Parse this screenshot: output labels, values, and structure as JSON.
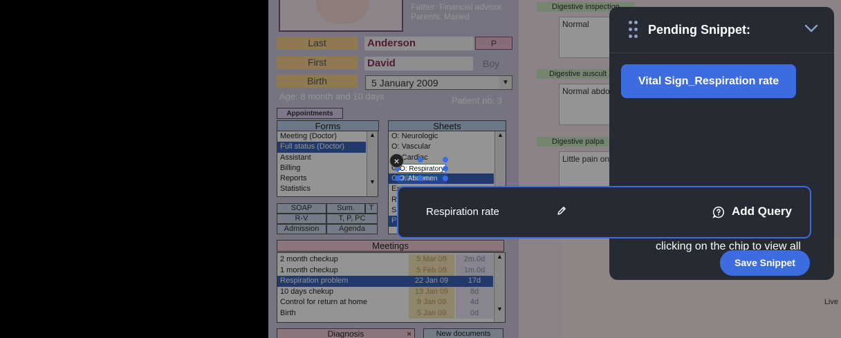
{
  "patient": {
    "father": "Father: Financial advisor",
    "parents": "Parents: Maried",
    "last_label": "Last",
    "last_value": "Anderson",
    "p_button": "P",
    "first_label": "First",
    "first_value": "David",
    "sex": "Boy",
    "birth_label": "Birth",
    "birth_value": "5   January   2009",
    "age": "Age: 8 month and 10 days",
    "patient_nb": "Patient nb: 3",
    "appointments": "Appointments"
  },
  "forms": {
    "header": "Forms",
    "items": [
      "Meeting (Doctor)",
      "Full status (Doctor)",
      "Assistant",
      "Billing",
      "Reports",
      "Statistics"
    ],
    "selected_index": 1
  },
  "sheets": {
    "header": "Sheets",
    "items": [
      "O: Neurologic",
      "O: Vascular",
      "O: Cardiac",
      "O: Respiratory",
      "O: Abdomen",
      "Ex",
      "R",
      "S",
      "P"
    ],
    "selected_index": 4
  },
  "buttons": {
    "soap": "SOAP",
    "sum": "Sum.",
    "t": "T",
    "rv": "R-V",
    "tppc": "T, P, PC",
    "admission": "Admission",
    "agenda": "Agenda"
  },
  "meetings": {
    "header": "Meetings",
    "rows": [
      {
        "name": "2 month checkup",
        "date": "5 Mar 09",
        "span": "2m.0d"
      },
      {
        "name": "1 month checkup",
        "date": "5 Feb 09",
        "span": "1m.0d"
      },
      {
        "name": "Respiration problem",
        "date": "22 Jan 09",
        "span": "17d"
      },
      {
        "name": "10 days chekup",
        "date": "13 Jan 09",
        "span": "8d"
      },
      {
        "name": "Control for return at home",
        "date": "9 Jan 09",
        "span": "4d"
      },
      {
        "name": "Birth",
        "date": "5 Jan 09",
        "span": "0d"
      }
    ],
    "selected_index": 2
  },
  "diagnosis": {
    "label": "Diagnosis",
    "close": "×"
  },
  "new_documents": "New documents",
  "exam": {
    "inspection_label": "Digestive inspection",
    "inspection_value": "Normal",
    "auscultation_label": "Digestive auscult",
    "auscultation_value": "Normal abdo",
    "palpation_label": "Digestive palpa",
    "palpation_value": "Little pain on",
    "anatomy_label": "Live"
  },
  "selection": {
    "highlighted_text": "O: Respiratory",
    "second_line": "O: Abdomen",
    "close": "×"
  },
  "snippet_panel": {
    "title": "Pending Snippet:",
    "chip": "Vital Sign_Respiration rate",
    "hint": "clicking on the chip to view all",
    "save_button": "Save Snippet"
  },
  "query_bar": {
    "label": "Respiration rate",
    "add_query": "Add Query"
  },
  "colors": {
    "accent": "#3d6be0",
    "panel_bg": "#262a33"
  },
  "icons": [
    "grip-icon",
    "chevron-down-icon",
    "pencil-icon",
    "question-circle-icon",
    "close-icon"
  ]
}
